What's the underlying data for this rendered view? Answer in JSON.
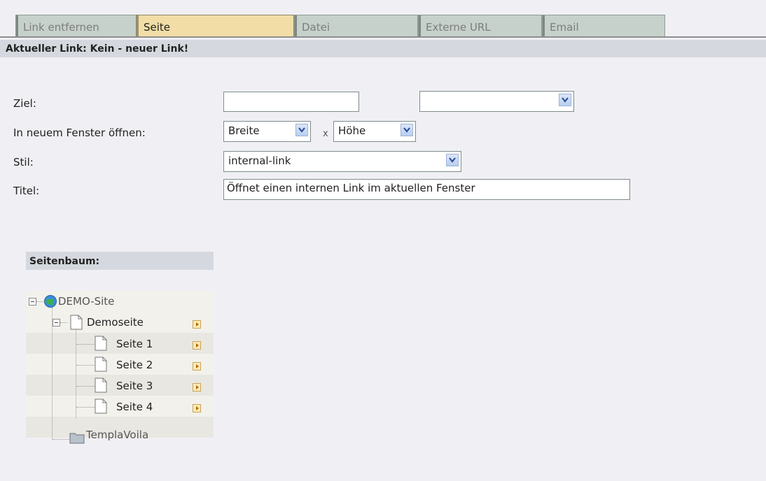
{
  "tabs": [
    {
      "label": "Link entfernen",
      "active": false
    },
    {
      "label": "Seite",
      "active": true
    },
    {
      "label": "Datei",
      "active": false
    },
    {
      "label": "Externe URL",
      "active": false
    },
    {
      "label": "Email",
      "active": false
    }
  ],
  "current_link": "Aktueller Link: Kein - neuer Link!",
  "form": {
    "ziel_label": "Ziel:",
    "ziel_value": "",
    "ziel_select_value": "",
    "window_label": "In neuem Fenster öffnen:",
    "width_select": "Breite",
    "times": "x",
    "height_select": "Höhe",
    "stil_label": "Stil:",
    "stil_value": "internal-link",
    "titel_label": "Titel:",
    "titel_value": "Öffnet einen internen Link im aktuellen Fenster"
  },
  "tree": {
    "heading": "Seitenbaum:",
    "root": "DEMO-Site",
    "page": "Demoseite",
    "children": [
      "Seite 1",
      "Seite 2",
      "Seite 3",
      "Seite 4"
    ],
    "folder": "TemplaVoila"
  },
  "colors": {
    "tab_inactive": "#c6d1cb",
    "tab_active": "#f1dda5",
    "header_bar": "#d5d9df",
    "background": "#f0f0f4"
  }
}
